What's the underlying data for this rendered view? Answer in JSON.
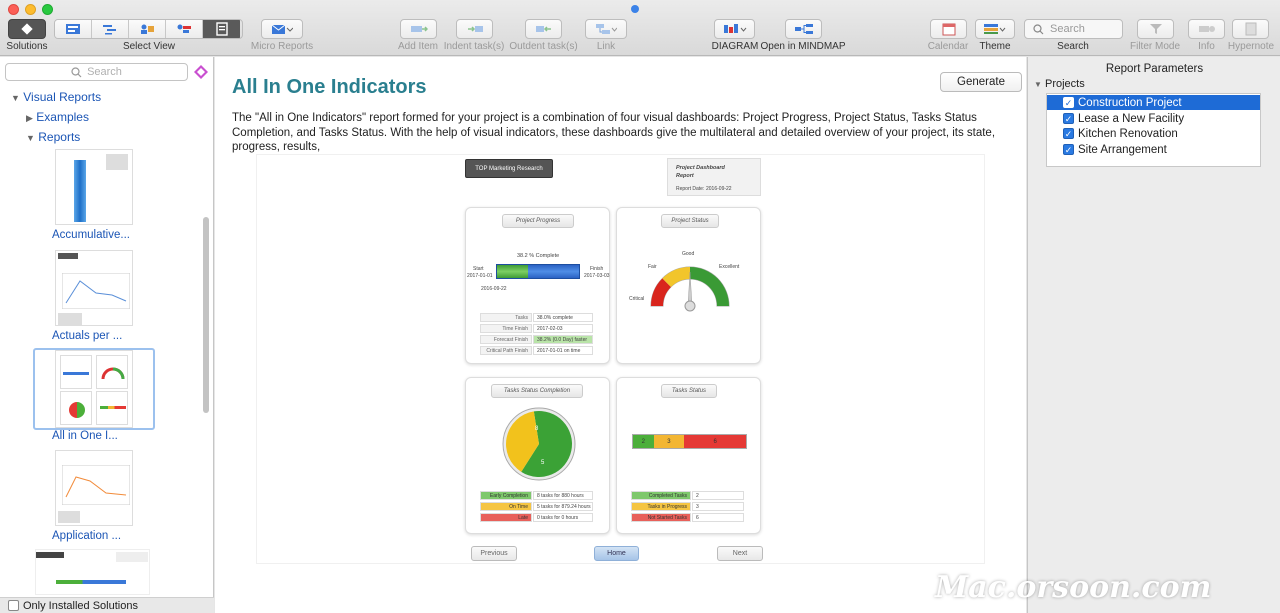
{
  "toolbar": {
    "solutions_label": "Solutions",
    "select_view_label": "Select View",
    "micro_reports_label": "Micro Reports",
    "add_item_label": "Add Item",
    "indent_label": "Indent task(s)",
    "outdent_label": "Outdent task(s)",
    "link_label": "Link",
    "diagram_label": "DIAGRAM",
    "mindmap_label": "Open in MINDMAP",
    "calendar_label": "Calendar",
    "theme_label": "Theme",
    "search_label": "Search",
    "search_placeholder": "Search",
    "filter_label": "Filter Mode",
    "info_label": "Info",
    "hypernote_label": "Hypernote"
  },
  "sidebar": {
    "search_placeholder": "Search",
    "root": "Visual Reports",
    "examples": "Examples",
    "reports": "Reports",
    "items": [
      {
        "label": "Accumulative..."
      },
      {
        "label": "Actuals per ..."
      },
      {
        "label": "All in One I..."
      },
      {
        "label": "Application ..."
      }
    ],
    "only_installed": "Only Installed Solutions"
  },
  "main": {
    "title": "All In One Indicators",
    "generate": "Generate",
    "description": "The \"All in One Indicators\" report formed for your project is a combination of four visual dashboards: Project Progress, Project Status, Tasks Status Completion, and Tasks Status. With the help of visual indicators, these dashboards give the multilateral and detailed overview of your project, its state, progress, results,"
  },
  "report": {
    "company": "TOP Marketing Research",
    "header_title": "Project Dashboard Report",
    "report_date_label": "Report Date:",
    "report_date": "2016-09-22",
    "progress": {
      "title": "Project Progress",
      "percent_text": "38.2 % Complete",
      "percent": 38.2,
      "start_label": "Start",
      "start_date": "2017-01-01",
      "finish_label": "Finish",
      "finish_date": "2017-03-03",
      "today": "2016-09-22",
      "rows": [
        {
          "label": "Tasks",
          "value": "38.0% complete"
        },
        {
          "label": "Time Finish",
          "value": "2017-02-03"
        },
        {
          "label": "Forecast Finish",
          "value": "38.2% (0.0 Day) faster"
        },
        {
          "label": "Critical Path Finish",
          "value": "2017-01-01  on time"
        }
      ]
    },
    "status": {
      "title": "Project Status",
      "good": "Good",
      "fair": "Fair",
      "excellent": "Excellent",
      "critical": "Critical"
    },
    "completion": {
      "title": "Tasks Status Completion",
      "pie_values": [
        8,
        5
      ],
      "pie_labels": [
        "8",
        "5"
      ],
      "rows": [
        {
          "label": "Early Completion",
          "value": "8 tasks for 880 hours",
          "color": "#7ec86c"
        },
        {
          "label": "On Time",
          "value": "5 tasks for 879.24 hours",
          "color": "#f5c542"
        },
        {
          "label": "Late",
          "value": "0 tasks for 0 hours",
          "color": "#e8605a"
        }
      ]
    },
    "tasks_status": {
      "title": "Tasks Status",
      "bar": [
        {
          "value": "2",
          "color": "#4caf3a"
        },
        {
          "value": "3",
          "color": "#f3b632"
        },
        {
          "value": "6",
          "color": "#e53935"
        }
      ],
      "rows": [
        {
          "label": "Completed Tasks",
          "value": "2",
          "color": "#7ec86c"
        },
        {
          "label": "Tasks in Progress",
          "value": "3",
          "color": "#f5c542"
        },
        {
          "label": "Not Started Tasks",
          "value": "6",
          "color": "#e8605a"
        }
      ]
    },
    "nav": {
      "previous": "Previous",
      "home": "Home",
      "next": "Next"
    }
  },
  "right": {
    "title": "Report Parameters",
    "projects_label": "Projects",
    "projects": [
      {
        "name": "Construction Project",
        "checked": true
      },
      {
        "name": "Lease a New Facility",
        "checked": true
      },
      {
        "name": "Kitchen Renovation",
        "checked": true
      },
      {
        "name": "Site Arrangement",
        "checked": true
      }
    ]
  },
  "watermark": "Mac.orsoon.com"
}
